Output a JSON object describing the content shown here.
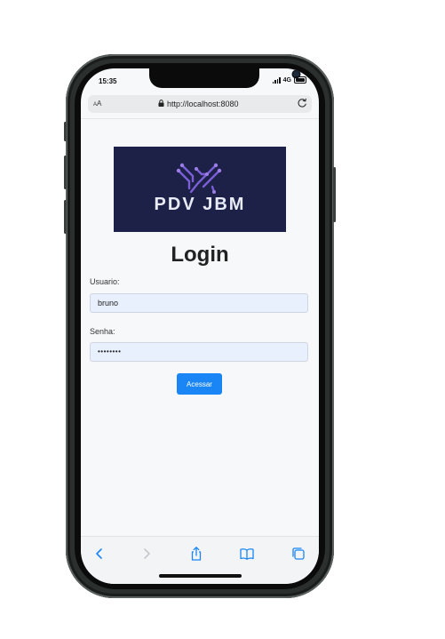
{
  "status": {
    "time": "15:35",
    "network": "4G"
  },
  "browser": {
    "text_size_label_small": "A",
    "text_size_label_large": "A",
    "url": "http://localhost:8080"
  },
  "logo": {
    "text": "PDV JBM",
    "background": "#1d2147"
  },
  "login": {
    "title": "Login",
    "username_label": "Usuario:",
    "username_value": "bruno",
    "password_label": "Senha:",
    "password_value": "••••••••",
    "submit_label": "Acessar"
  },
  "colors": {
    "accent": "#1a86f5",
    "field_bg": "#e8f0fd",
    "tab_icon": "#1a86f5",
    "tab_icon_disabled": "#c5c8cd"
  },
  "toolbar": {
    "icons": [
      "back-icon",
      "forward-icon",
      "share-icon",
      "bookmarks-icon",
      "tabs-icon"
    ]
  }
}
